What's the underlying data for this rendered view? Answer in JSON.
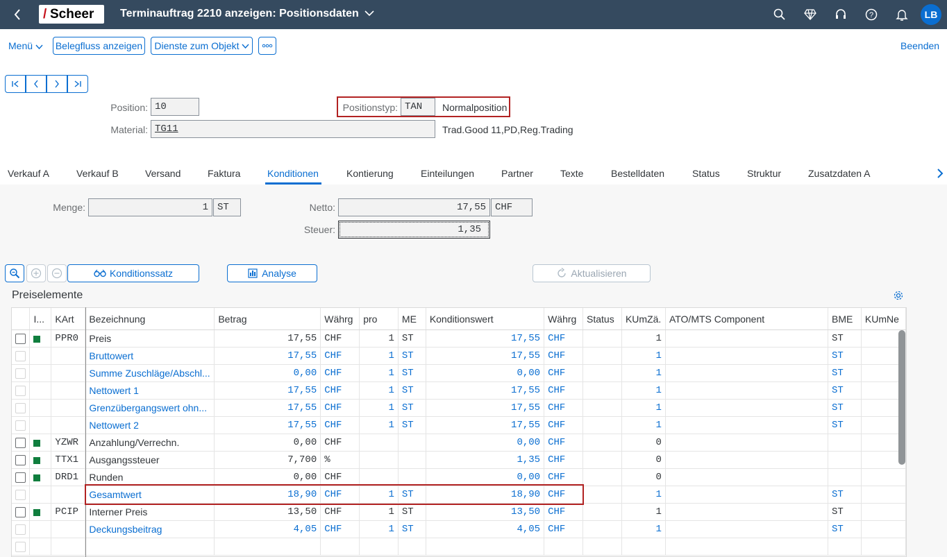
{
  "shell": {
    "title": "Terminauftrag 2210 anzeigen: Positionsdaten",
    "logo": "Scheer",
    "avatar": "LB"
  },
  "toolbar": {
    "menu": "Menü",
    "belegfluss": "Belegfluss anzeigen",
    "dienste": "Dienste zum Objekt",
    "beenden": "Beenden"
  },
  "nav": {
    "first": "I<",
    "prev": "<",
    "next": ">",
    "last": ">I"
  },
  "header": {
    "position_label": "Position:",
    "position_value": "10",
    "material_label": "Material:",
    "material_value": "TG11",
    "material_desc": "Trad.Good 11,PD,Reg.Trading",
    "postyp_label": "Positionstyp:",
    "postyp_value": "TAN",
    "postyp_desc": "Normalposition"
  },
  "tabs": [
    "Verkauf A",
    "Verkauf B",
    "Versand",
    "Faktura",
    "Konditionen",
    "Kontierung",
    "Einteilungen",
    "Partner",
    "Texte",
    "Bestelldaten",
    "Status",
    "Struktur",
    "Zusatzdaten A"
  ],
  "active_tab": "Konditionen",
  "summary": {
    "menge_label": "Menge:",
    "menge_value": "1",
    "menge_unit": "ST",
    "netto_label": "Netto:",
    "netto_value": "17,55",
    "netto_curr": "CHF",
    "steuer_label": "Steuer:",
    "steuer_value": "1,35"
  },
  "actions": {
    "konditionssatz": "Konditionssatz",
    "analyse": "Analyse",
    "aktualisieren": "Aktualisieren"
  },
  "section_title": "Preiselemente",
  "columns": [
    "I...",
    "KArt",
    "Bezeichnung",
    "Betrag",
    "Währg",
    "pro",
    "ME",
    "Konditionswert",
    "Währg",
    "Status",
    "KUmZä.",
    "ATO/MTS Component",
    "BME",
    "KUmNe"
  ],
  "rows": [
    {
      "active": true,
      "kart": "PPR0",
      "bez": "Preis",
      "betrag": "17,55",
      "waehrg": "CHF",
      "pro": "1",
      "me": "ST",
      "kwert": "17,55",
      "kwaehrg": "CHF",
      "kumz": "1",
      "bme": "ST",
      "blue": false
    },
    {
      "active": false,
      "kart": "",
      "bez": "Bruttowert",
      "betrag": "17,55",
      "waehrg": "CHF",
      "pro": "1",
      "me": "ST",
      "kwert": "17,55",
      "kwaehrg": "CHF",
      "kumz": "1",
      "bme": "ST",
      "blue": true
    },
    {
      "active": false,
      "kart": "",
      "bez": "Summe Zuschläge/Abschl...",
      "betrag": "0,00",
      "waehrg": "CHF",
      "pro": "1",
      "me": "ST",
      "kwert": "0,00",
      "kwaehrg": "CHF",
      "kumz": "1",
      "bme": "ST",
      "blue": true
    },
    {
      "active": false,
      "kart": "",
      "bez": "Nettowert 1",
      "betrag": "17,55",
      "waehrg": "CHF",
      "pro": "1",
      "me": "ST",
      "kwert": "17,55",
      "kwaehrg": "CHF",
      "kumz": "1",
      "bme": "ST",
      "blue": true
    },
    {
      "active": false,
      "kart": "",
      "bez": "Grenzübergangswert ohn...",
      "betrag": "17,55",
      "waehrg": "CHF",
      "pro": "1",
      "me": "ST",
      "kwert": "17,55",
      "kwaehrg": "CHF",
      "kumz": "1",
      "bme": "ST",
      "blue": true
    },
    {
      "active": false,
      "kart": "",
      "bez": "Nettowert 2",
      "betrag": "17,55",
      "waehrg": "CHF",
      "pro": "1",
      "me": "ST",
      "kwert": "17,55",
      "kwaehrg": "CHF",
      "kumz": "1",
      "bme": "ST",
      "blue": true
    },
    {
      "active": true,
      "kart": "YZWR",
      "bez": "Anzahlung/Verrechn.",
      "betrag": "0,00",
      "waehrg": "CHF",
      "pro": "",
      "me": "",
      "kwert": "0,00",
      "kwaehrg": "CHF",
      "kumz": "0",
      "bme": "",
      "blue": false
    },
    {
      "active": true,
      "kart": "TTX1",
      "bez": "Ausgangssteuer",
      "betrag": "7,700",
      "waehrg": "%",
      "pro": "",
      "me": "",
      "kwert": "1,35",
      "kwaehrg": "CHF",
      "kumz": "0",
      "bme": "",
      "blue": false
    },
    {
      "active": true,
      "kart": "DRD1",
      "bez": "Runden",
      "betrag": "0,00",
      "waehrg": "CHF",
      "pro": "",
      "me": "",
      "kwert": "0,00",
      "kwaehrg": "CHF",
      "kumz": "0",
      "bme": "",
      "blue": false
    },
    {
      "active": false,
      "kart": "",
      "bez": "Gesamtwert",
      "betrag": "18,90",
      "waehrg": "CHF",
      "pro": "1",
      "me": "ST",
      "kwert": "18,90",
      "kwaehrg": "CHF",
      "kumz": "1",
      "bme": "ST",
      "blue": true
    },
    {
      "active": true,
      "kart": "PCIP",
      "bez": "Interner Preis",
      "betrag": "13,50",
      "waehrg": "CHF",
      "pro": "1",
      "me": "ST",
      "kwert": "13,50",
      "kwaehrg": "CHF",
      "kumz": "1",
      "bme": "ST",
      "blue": false
    },
    {
      "active": false,
      "kart": "",
      "bez": "Deckungsbeitrag",
      "betrag": "4,05",
      "waehrg": "CHF",
      "pro": "1",
      "me": "ST",
      "kwert": "4,05",
      "kwaehrg": "CHF",
      "kumz": "1",
      "bme": "ST",
      "blue": true
    },
    {
      "active": false,
      "kart": "",
      "bez": "",
      "betrag": "",
      "waehrg": "",
      "pro": "",
      "me": "",
      "kwert": "",
      "kwaehrg": "",
      "kumz": "",
      "bme": "",
      "blue": false
    }
  ],
  "colors": {
    "shell": "#354a5f",
    "accent": "#0a6ed1",
    "highlight": "#b22222",
    "active_green": "#107e3e"
  }
}
